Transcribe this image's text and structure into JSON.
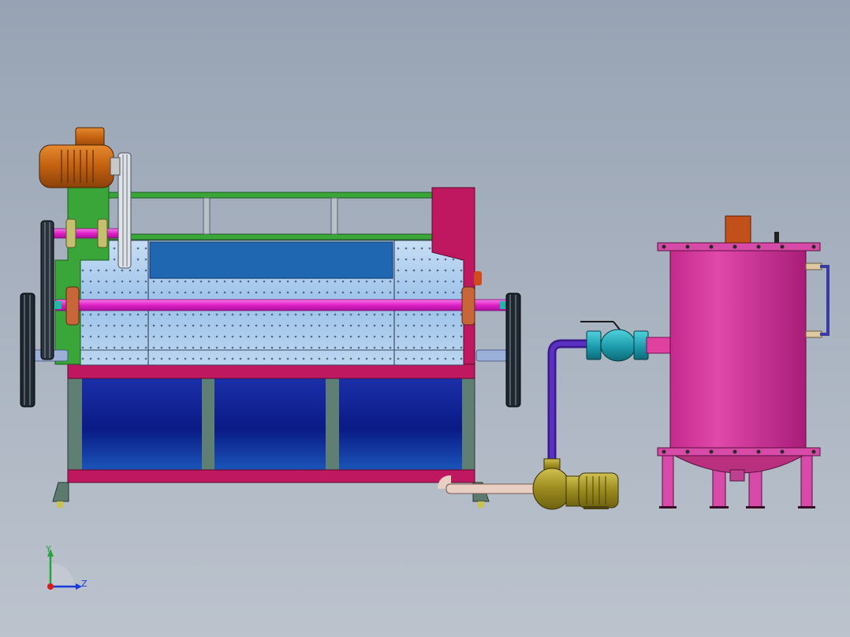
{
  "viewport": {
    "background_top": "#97a3b4",
    "background_bottom": "#bcc3cd"
  },
  "model": {
    "components": [
      "drive-motor-icon",
      "pulley-icon",
      "perforated-drum-icon",
      "collection-tank-icon",
      "ball-valve-icon",
      "centrifugal-pump-icon",
      "storage-vessel-icon"
    ],
    "colors": {
      "frame_green": "#3aa63a",
      "drum_blue": "#9dc6ee",
      "shaft_magenta": "#e020c8",
      "trim_crimson": "#c01860",
      "tank_navy": "#102090",
      "vessel_pink": "#d83aa0",
      "motor_orange": "#d9701a",
      "pump_gold": "#a8962a",
      "valve_cyan": "#22a7b5",
      "pipe_indigo": "#4a1fa0"
    }
  },
  "triad": {
    "y_label": "Y",
    "z_label": "Z",
    "y_color": "#22a63a",
    "z_color": "#1a3ad8",
    "origin_color": "#d81a1a"
  }
}
